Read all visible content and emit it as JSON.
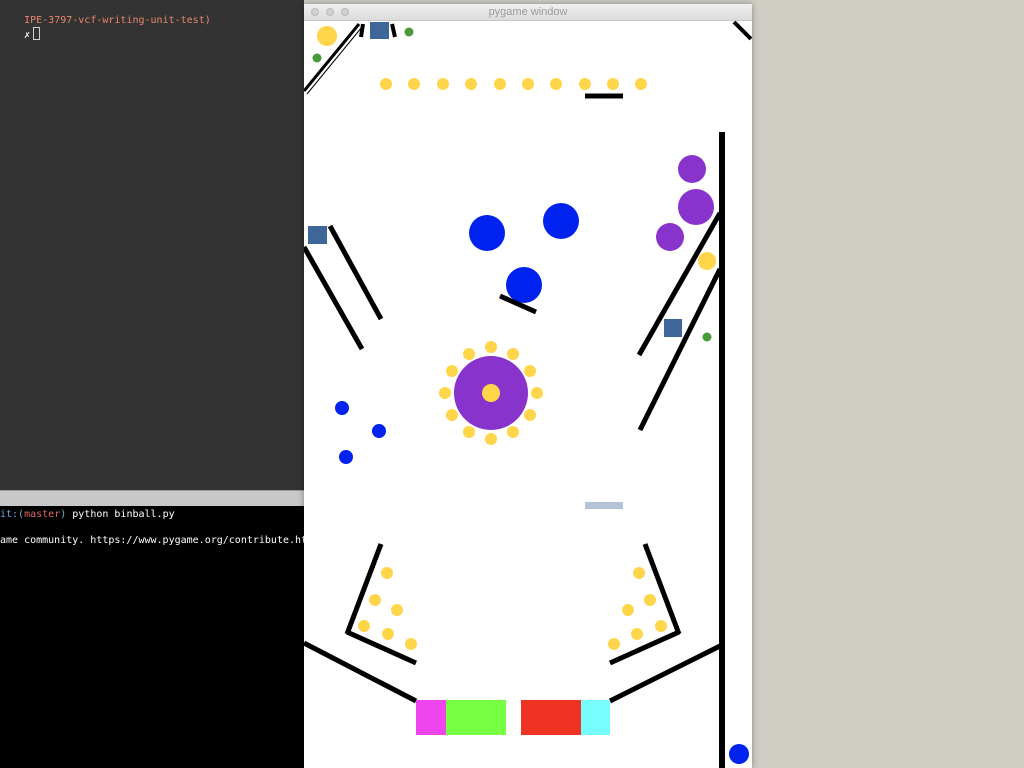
{
  "terminal_top": {
    "prompt_branch": "IPE-3797-vcf-writing-unit-test)",
    "prompt_symbol": "✗"
  },
  "terminal_bottom": {
    "git_prefix": "it:(",
    "branch": "master",
    "git_suffix": ")",
    "command": " python binball.py",
    "output_line": "ame community. https://www.pygame.org/contribute.html"
  },
  "window": {
    "title": "pygame window"
  },
  "colors": {
    "bumper_yellow": "#ffd54a",
    "bumper_blue": "#0022ee",
    "bumper_purple": "#8833cc",
    "target_square": "#3e6698",
    "dot_green": "#4a9a3a",
    "wall": "#000000",
    "paddle": "#b4c3d8",
    "goal_magenta": "#ee44ee",
    "goal_green": "#77ff44",
    "goal_red": "#ee3322",
    "goal_cyan": "#77ffff"
  }
}
